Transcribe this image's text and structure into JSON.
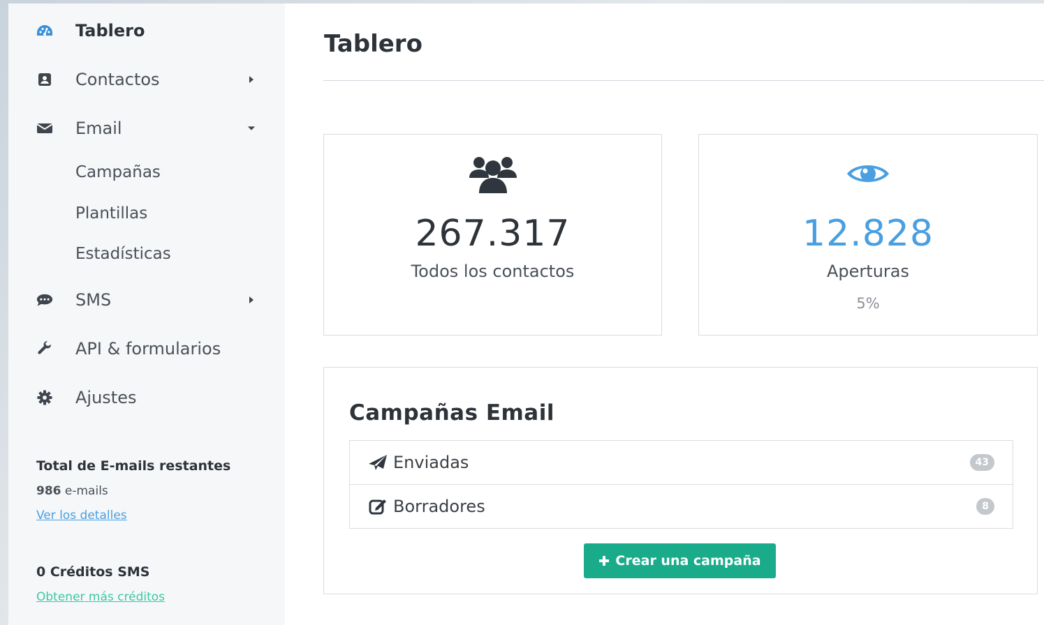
{
  "sidebar": {
    "items": [
      {
        "label": "Tablero",
        "icon": "dashboard-icon"
      },
      {
        "label": "Contactos",
        "icon": "address-book-icon"
      },
      {
        "label": "Email",
        "icon": "envelope-icon"
      },
      {
        "label": "SMS",
        "icon": "chat-icon"
      },
      {
        "label": "API & formularios",
        "icon": "wrench-icon"
      },
      {
        "label": "Ajustes",
        "icon": "gear-icon"
      }
    ],
    "email_subitems": [
      "Campañas",
      "Plantillas",
      "Estadísticas"
    ],
    "emails_title": "Total de E-mails restantes",
    "emails_count": "986",
    "emails_unit": "e-mails",
    "emails_link": "Ver los detalles",
    "sms_title": "0 Créditos SMS",
    "sms_link": "Obtener más créditos"
  },
  "main": {
    "title": "Tablero",
    "cards": [
      {
        "value": "267.317",
        "label": "Todos los contactos",
        "icon": "users-icon"
      },
      {
        "value": "12.828",
        "label": "Aperturas",
        "sub": "5%",
        "icon": "eye-icon"
      }
    ],
    "campaigns": {
      "title": "Campañas Email",
      "rows": [
        {
          "label": "Enviadas",
          "count": "43",
          "icon": "paper-plane-icon"
        },
        {
          "label": "Borradores",
          "count": "8",
          "icon": "edit-icon"
        }
      ],
      "button": "Crear una campaña"
    }
  },
  "colors": {
    "accent_blue": "#4a9fe0",
    "button_green": "#1aab8a",
    "link_green": "#3dc8a0",
    "badge_gray": "#c3c8cd"
  }
}
